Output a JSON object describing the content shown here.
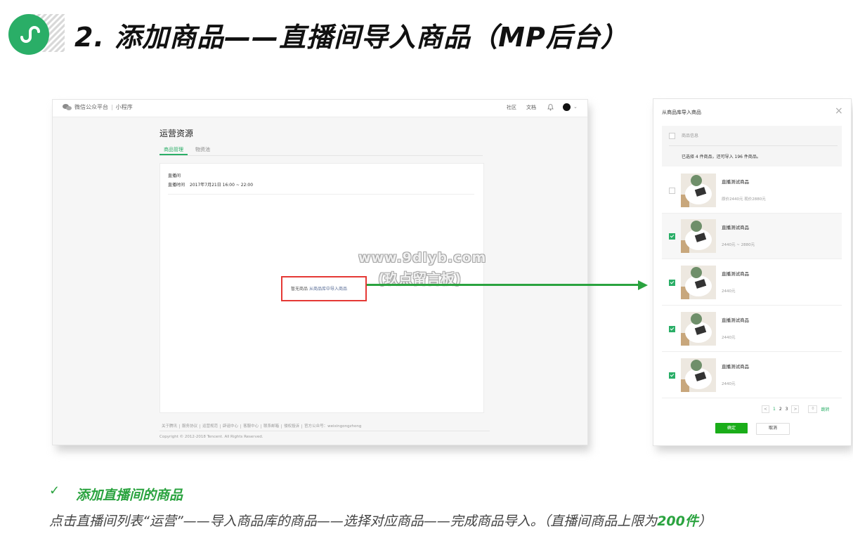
{
  "header": {
    "title": "2. 添加商品——直播间导入商品（MP后台）"
  },
  "mp_console": {
    "brand": "微信公众平台",
    "product": "小程序",
    "nav": {
      "community": "社区",
      "docs": "文档"
    },
    "page_heading": "运营资源",
    "tabs": [
      "商品管理",
      "物资池"
    ],
    "room": {
      "label": "直播间",
      "time_key": "直播时间",
      "time_value": "2017年7月21日 16:00 ~ 22:00"
    },
    "empty": {
      "text": "暂无商品",
      "link": "从商品库中导入商品"
    },
    "footer_links": [
      "关于腾讯",
      "服务协议",
      "运营规范",
      "辟谣中心",
      "客服中心",
      "联系邮箱",
      "侵权投诉",
      "官方公众号：weixingongzhong"
    ],
    "copyright": "Copyright © 2012-2018 Tencent. All Rights Reserved."
  },
  "watermark": {
    "line1": "www.9dlyb.com",
    "line2": "(玖点留言板)"
  },
  "dialog": {
    "title": "从商品库导入商品",
    "close": "×",
    "header_label": "商品信息",
    "selection_summary": "已选择 4 件商品，还可导入 196 件商品。",
    "items": [
      {
        "name": "直播测试商品",
        "price": "原价2440元    现价2880元",
        "checked": false
      },
      {
        "name": "直播测试商品",
        "price": "2440元 ~ 2880元",
        "checked": true
      },
      {
        "name": "直播测试商品",
        "price": "2440元",
        "checked": true
      },
      {
        "name": "直播测试商品",
        "price": "2440元",
        "checked": true
      },
      {
        "name": "直播测试商品",
        "price": "2440元",
        "checked": true
      }
    ],
    "pagination": {
      "prev": "<",
      "pages": [
        "1",
        "2",
        "3"
      ],
      "next": ">",
      "jump_input": "0",
      "jump_label": "跳转"
    },
    "confirm": "确定",
    "cancel": "取消"
  },
  "bottom": {
    "check": "✓",
    "subtitle": "添加直播间的商品",
    "desc_prefix": "点击直播间列表“运营”——导入商品库的商品——选择对应商品——完成商品导入。（直播间商品上限为",
    "desc_highlight": "200件",
    "desc_suffix": "）"
  },
  "colors": {
    "brand_green": "#2aae67",
    "accent_green": "#2aa33f",
    "highlight_red": "#e53935"
  }
}
